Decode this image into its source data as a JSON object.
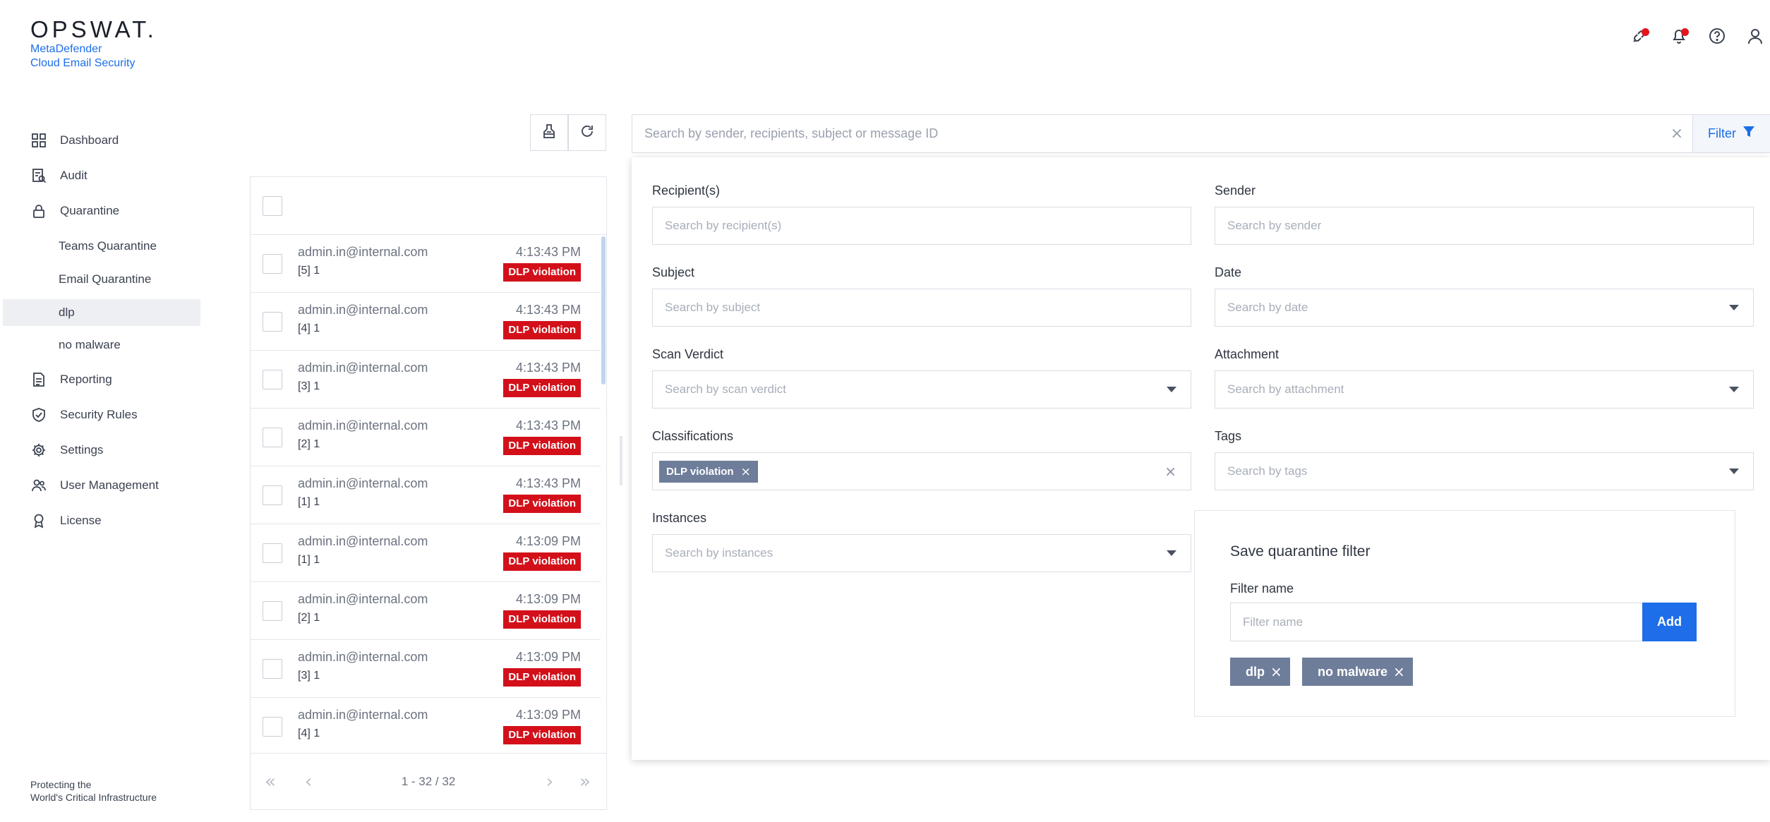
{
  "brand": {
    "wordmark": "OPSWAT.",
    "product_line1": "MetaDefender",
    "product_line2": "Cloud Email Security",
    "tagline_line1": "Protecting the",
    "tagline_line2": "World's Critical Infrastructure"
  },
  "sidebar": {
    "items": [
      {
        "label": "Dashboard",
        "icon": "dashboard-icon"
      },
      {
        "label": "Audit",
        "icon": "audit-icon"
      },
      {
        "label": "Quarantine",
        "icon": "lock-icon"
      },
      {
        "label": "Teams Quarantine"
      },
      {
        "label": "Email Quarantine"
      },
      {
        "label": "dlp",
        "active": true
      },
      {
        "label": "no malware"
      },
      {
        "label": "Reporting",
        "icon": "report-icon"
      },
      {
        "label": "Security Rules",
        "icon": "shield-check-icon"
      },
      {
        "label": "Settings",
        "icon": "gear-icon"
      },
      {
        "label": "User Management",
        "icon": "users-icon"
      },
      {
        "label": "License",
        "icon": "ribbon-icon"
      }
    ]
  },
  "header": {
    "icons": [
      "integration-icon",
      "bell-icon",
      "help-icon",
      "user-icon"
    ],
    "notification_color": "#e5131d"
  },
  "toolbar": {
    "icons": [
      "clean-icon",
      "refresh-icon"
    ]
  },
  "messages": {
    "rows": [
      {
        "email": "admin.in@internal.com",
        "subject": "[5] 1",
        "time": "4:13:43 PM",
        "badge": "DLP violation"
      },
      {
        "email": "admin.in@internal.com",
        "subject": "[4] 1",
        "time": "4:13:43 PM",
        "badge": "DLP violation"
      },
      {
        "email": "admin.in@internal.com",
        "subject": "[3] 1",
        "time": "4:13:43 PM",
        "badge": "DLP violation"
      },
      {
        "email": "admin.in@internal.com",
        "subject": "[2] 1",
        "time": "4:13:43 PM",
        "badge": "DLP violation"
      },
      {
        "email": "admin.in@internal.com",
        "subject": "[1] 1",
        "time": "4:13:43 PM",
        "badge": "DLP violation"
      },
      {
        "email": "admin.in@internal.com",
        "subject": "[1] 1",
        "time": "4:13:09 PM",
        "badge": "DLP violation"
      },
      {
        "email": "admin.in@internal.com",
        "subject": "[2] 1",
        "time": "4:13:09 PM",
        "badge": "DLP violation"
      },
      {
        "email": "admin.in@internal.com",
        "subject": "[3] 1",
        "time": "4:13:09 PM",
        "badge": "DLP violation"
      },
      {
        "email": "admin.in@internal.com",
        "subject": "[4] 1",
        "time": "4:13:09 PM",
        "badge": "DLP violation"
      }
    ],
    "badge_color": "#d3101a",
    "pagination": {
      "text": "1 - 32 / 32",
      "first": "«",
      "prev": "‹",
      "next": "›",
      "last": "»"
    }
  },
  "search": {
    "placeholder": "Search by sender, recipients, subject or message ID",
    "clear": "×",
    "filter_label": "Filter"
  },
  "filters": {
    "recipients": {
      "label": "Recipient(s)",
      "placeholder": "Search by recipient(s)"
    },
    "sender": {
      "label": "Sender",
      "placeholder": "Search by sender"
    },
    "subject": {
      "label": "Subject",
      "placeholder": "Search by subject"
    },
    "date": {
      "label": "Date",
      "placeholder": "Search by date"
    },
    "scan_verdict": {
      "label": "Scan Verdict",
      "placeholder": "Search by scan verdict"
    },
    "attachment": {
      "label": "Attachment",
      "placeholder": "Search by attachment"
    },
    "classifications": {
      "label": "Classifications",
      "chip": "DLP violation",
      "chip_remove": "×",
      "clear": "×"
    },
    "tags": {
      "label": "Tags",
      "placeholder": "Search by tags"
    },
    "instances": {
      "label": "Instances",
      "placeholder": "Search by instances"
    }
  },
  "save_filter": {
    "title": "Save quarantine filter",
    "name_label": "Filter name",
    "name_placeholder": "Filter name",
    "add_label": "Add",
    "saved": [
      {
        "label": "dlp",
        "remove": "×"
      },
      {
        "label": "no malware",
        "remove": "×"
      }
    ],
    "accent": "#1d6ee8",
    "tag_color": "#6e7d99"
  }
}
